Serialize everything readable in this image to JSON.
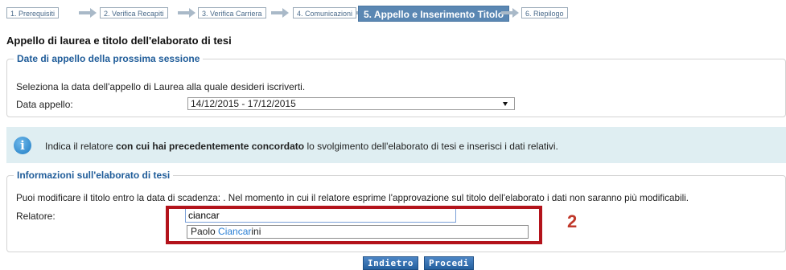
{
  "wizard": {
    "steps": [
      {
        "label": "1. Prerequisiti"
      },
      {
        "label": "2. Verifica Recapiti"
      },
      {
        "label": "3. Verifica Carriera"
      },
      {
        "label": "4. Comunicazioni"
      },
      {
        "label": "5. Appello e Inserimento Titolo"
      },
      {
        "label": "6. Riepilogo"
      }
    ],
    "active_step": 5
  },
  "page": {
    "title": "Appello di laurea e titolo dell'elaborato di tesi"
  },
  "session": {
    "legend": "Date di appello della prossima sessione",
    "instruction": "Seleziona la data dell'appello di Laurea alla quale desideri iscriverti.",
    "date_label": "Data appello:",
    "date_selected": "14/12/2015 - 17/12/2015"
  },
  "info": {
    "text_before": "Indica il relatore ",
    "text_bold": "con cui hai precedentemente concordato",
    "text_after": " lo svolgimento dell'elaborato di tesi e inserisci i dati relativi."
  },
  "thesis": {
    "legend": "Informazioni sull'elaborato di tesi",
    "note": "Puoi modificare il titolo entro la data di scadenza: . Nel momento in cui il relatore esprime l'approvazione sul titolo dell'elaborato i dati non saranno più modificabili.",
    "relatore_label": "Relatore:",
    "relatore_value": "ciancar",
    "suggestion_prefix": "Paolo ",
    "suggestion_match": "Ciancar",
    "suggestion_suffix": "ini"
  },
  "annotation": {
    "marker": "2",
    "color": "#b3131b"
  },
  "buttons": {
    "back": "Indietro",
    "next": "Procedi"
  },
  "colors": {
    "accent": "#5a87b3",
    "legend": "#1f5c99",
    "info_bg": "#dfeef2",
    "button": "#24609e"
  }
}
